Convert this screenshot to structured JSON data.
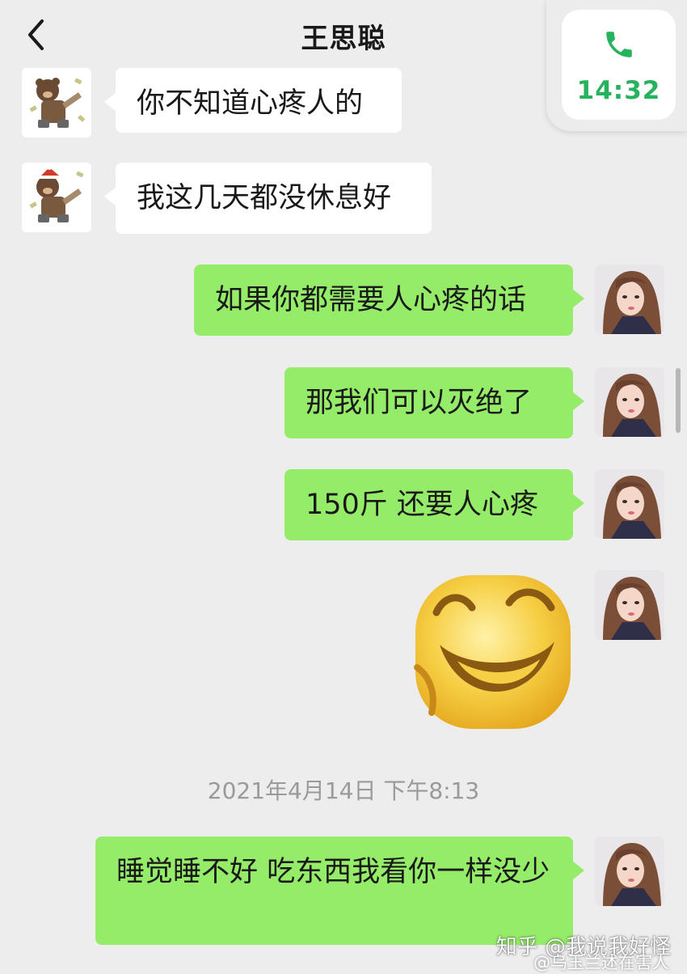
{
  "header": {
    "title": "王思聪",
    "back_icon": "chevron-left-icon"
  },
  "call_widget": {
    "icon": "phone-icon",
    "time": "14:32",
    "accent": "#27b25d"
  },
  "messages": [
    {
      "side": "in",
      "text": "你不知道心疼人的"
    },
    {
      "side": "in",
      "text": "我这几天都没休息好"
    },
    {
      "side": "out",
      "text": "如果你都需要人心疼的话"
    },
    {
      "side": "out",
      "text": "那我们可以灭绝了"
    },
    {
      "side": "out",
      "text": "150斤 还要人心疼"
    },
    {
      "side": "out",
      "type": "sticker",
      "sticker": "laughing-emoji-sticker"
    },
    {
      "side": "out",
      "text": "睡觉睡不好 吃东西我看你一样没少"
    }
  ],
  "timestamp": "2021年4月14日 下午8:13",
  "watermark": {
    "zhihu": "知乎 @我说我好怪",
    "weibo": "@乌玉兰述在害人"
  },
  "colors": {
    "background": "#ededed",
    "incoming_bubble": "#ffffff",
    "outgoing_bubble": "#95ec69"
  }
}
